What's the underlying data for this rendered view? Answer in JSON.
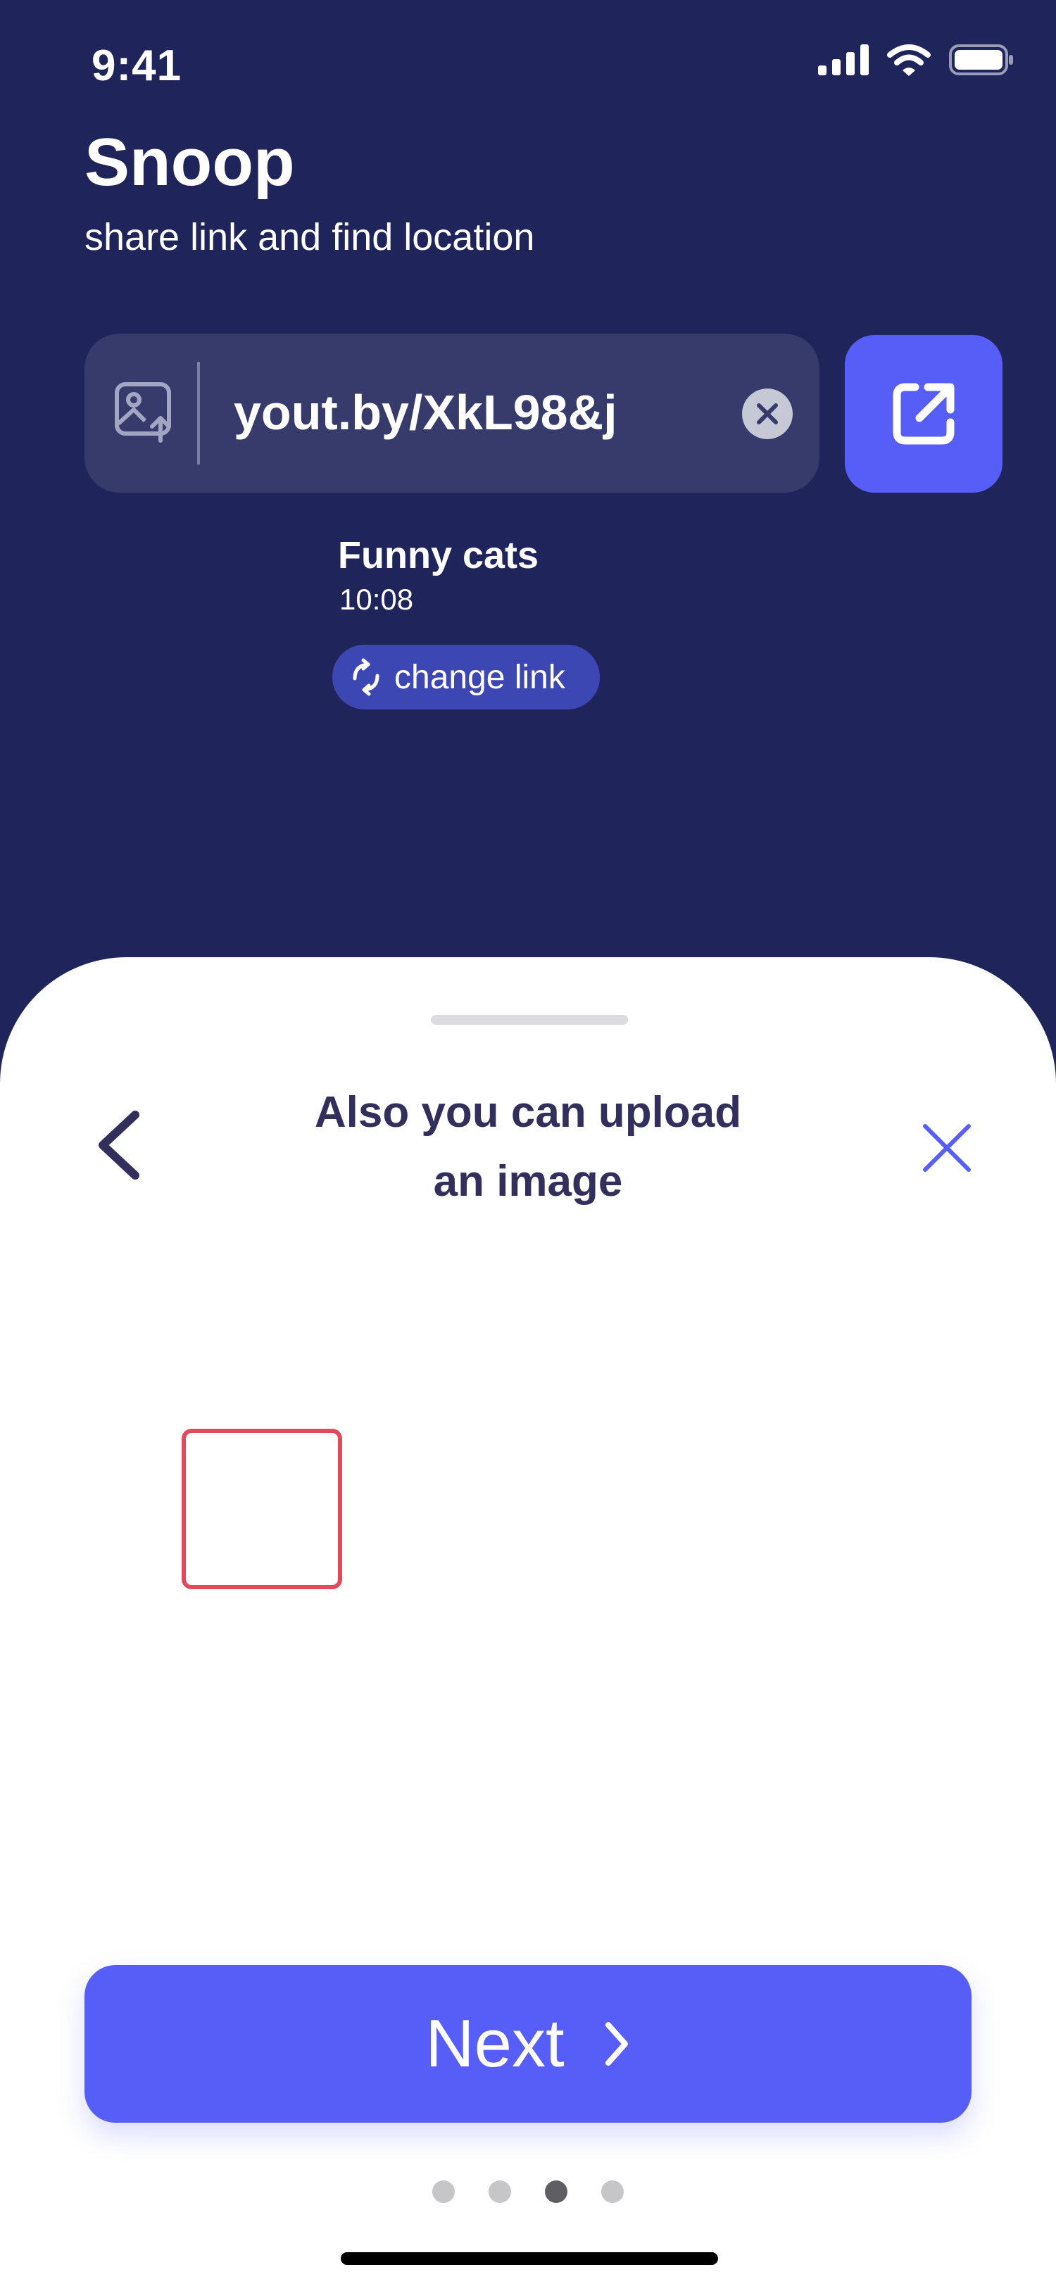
{
  "status_bar": {
    "time": "9:41",
    "icons": [
      "cellular-signal-icon",
      "wifi-icon",
      "battery-icon"
    ]
  },
  "header": {
    "title": "Snoop",
    "subtitle": "share link and find location"
  },
  "link_field": {
    "value": "yout.by/XkL98&j",
    "leading_icon": "image-upload-icon",
    "clear_icon": "clear-icon"
  },
  "open_button": {
    "icon": "external-link-icon"
  },
  "video": {
    "title": "Funny cats",
    "time": "10:08"
  },
  "change_link": {
    "label": "change link",
    "icon": "refresh-icon"
  },
  "sheet": {
    "title_line_1": "Also you can upload",
    "title_line_2": "an image",
    "back_icon": "chevron-left-icon",
    "close_icon": "close-icon"
  },
  "next_button": {
    "label": "Next",
    "icon": "chevron-right-icon"
  },
  "pagination": {
    "total": 4,
    "current": 3
  },
  "colors": {
    "background": "#1f255b",
    "field": "#363b6c",
    "accent": "#575ef7",
    "chip": "#3d47b4",
    "sheet_title": "#332f5c",
    "upload_border": "#e04a5b"
  }
}
